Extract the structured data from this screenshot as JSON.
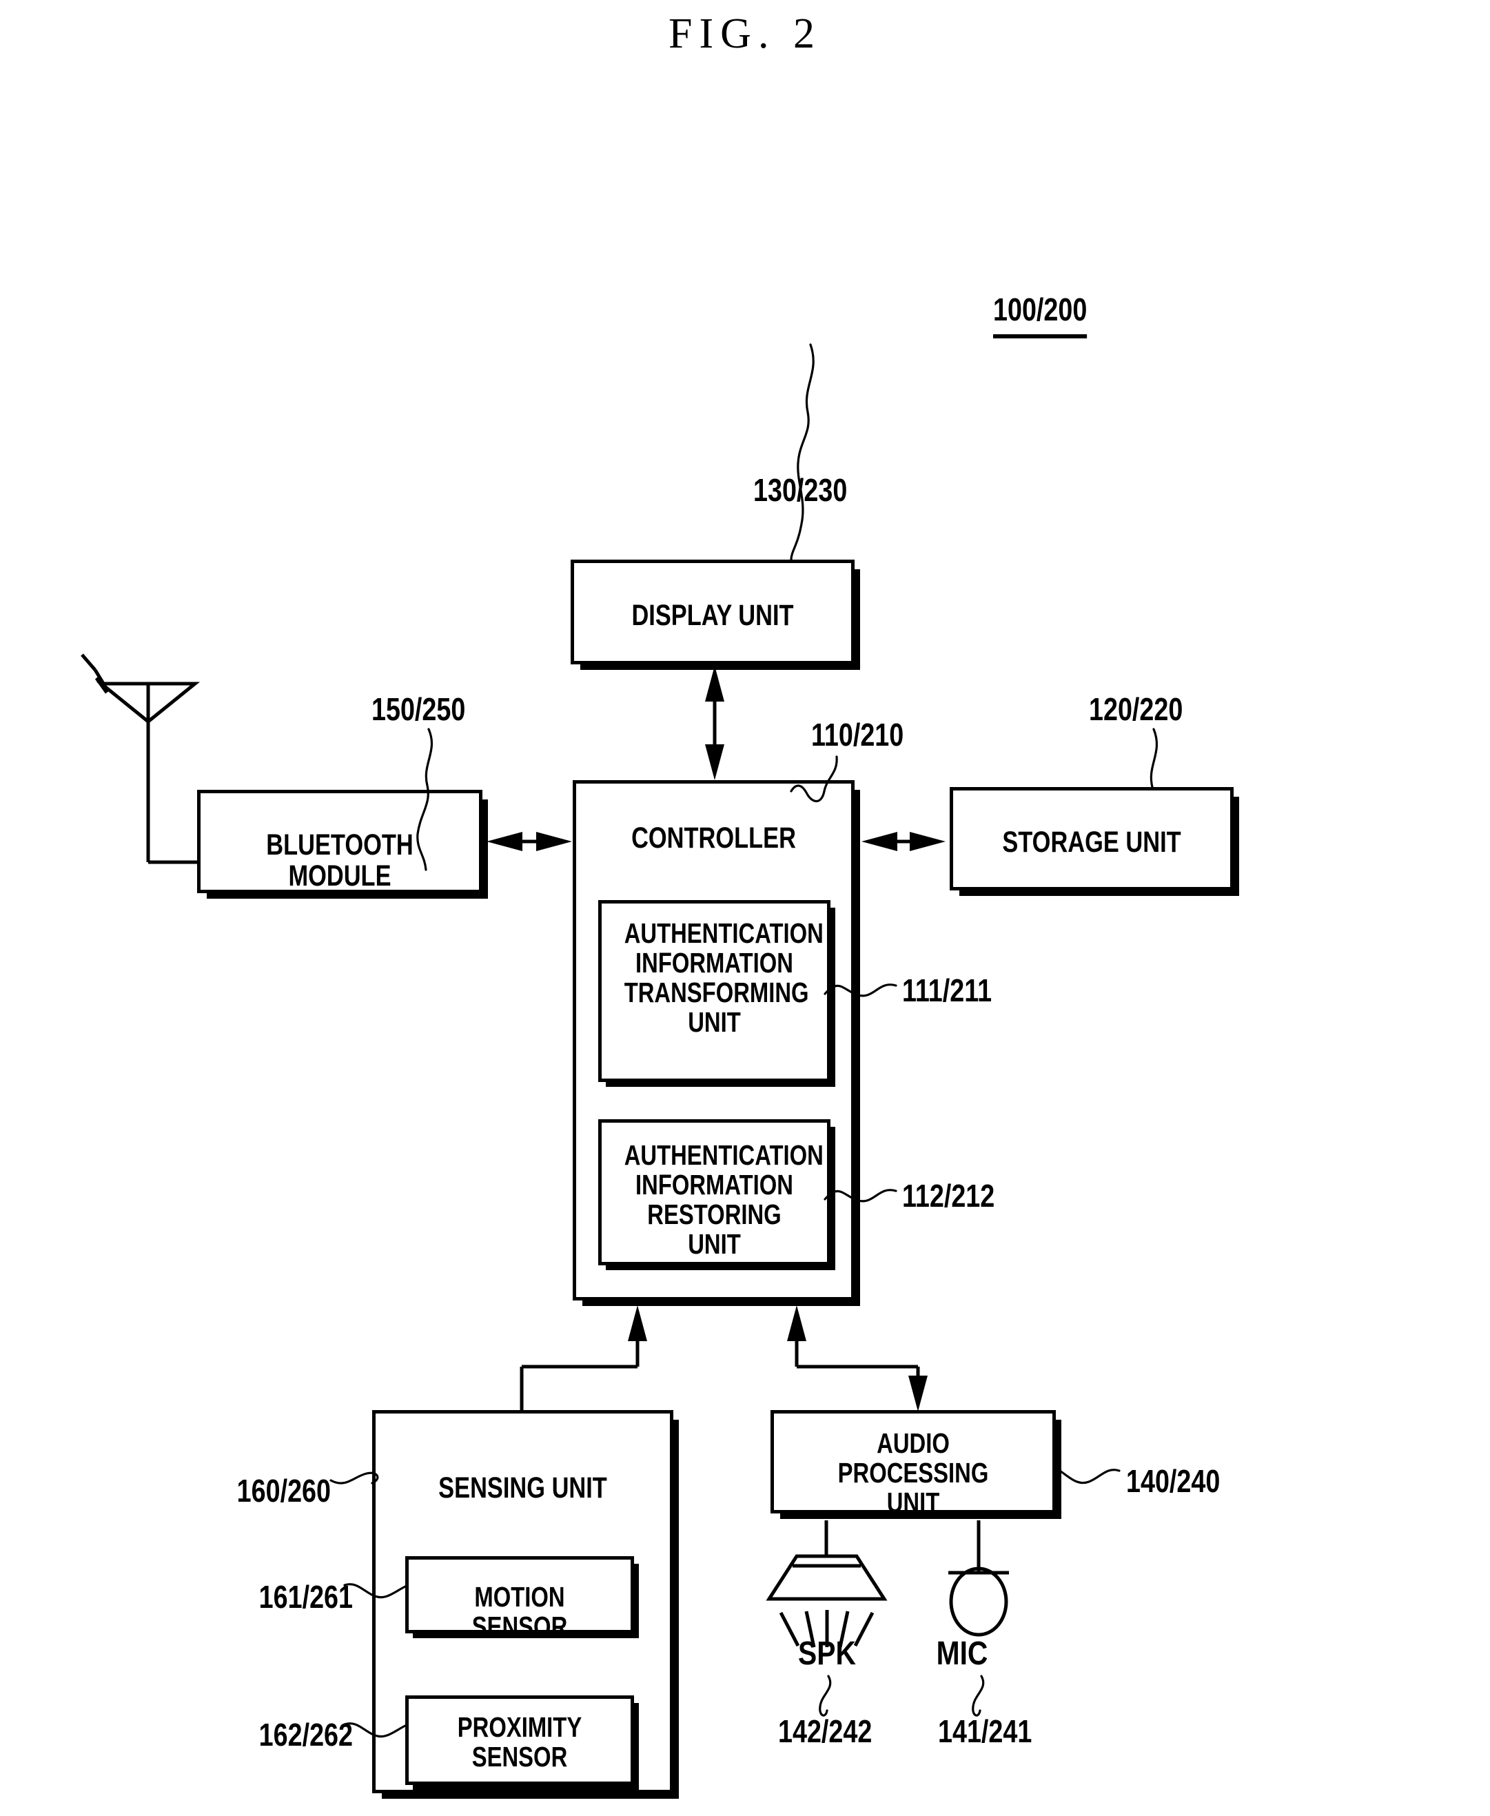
{
  "figure": {
    "title": "FIG. 2",
    "system_ref": "100/200"
  },
  "blocks": {
    "display_unit": {
      "label": "DISPLAY UNIT",
      "ref": "130/230"
    },
    "controller": {
      "label": "CONTROLLER",
      "ref": "110/210"
    },
    "bluetooth": {
      "label": "BLUETOOTH MODULE",
      "ref": "150/250"
    },
    "storage": {
      "label": "STORAGE UNIT",
      "ref": "120/220"
    },
    "auth_transform": {
      "label": "AUTHENTICATION\nINFORMATION\nTRANSFORMING\nUNIT",
      "ref": "111/211"
    },
    "auth_restore": {
      "label": "AUTHENTICATION\nINFORMATION\nRESTORING UNIT",
      "ref": "112/212"
    },
    "sensing": {
      "label": "SENSING UNIT",
      "ref": "160/260"
    },
    "motion_sensor": {
      "label": "MOTION SENSOR",
      "ref": "161/261"
    },
    "proximity_sensor": {
      "label": "PROXIMITY\nSENSOR",
      "ref": "162/262"
    },
    "audio": {
      "label": "AUDIO PROCESSING\nUNIT",
      "ref": "140/240"
    }
  },
  "peripherals": {
    "speaker": {
      "label": "SPK",
      "ref": "142/242",
      "icon": "speaker-icon"
    },
    "mic": {
      "label": "MIC",
      "ref": "141/241",
      "icon": "microphone-icon"
    },
    "antenna": {
      "icon": "antenna-icon"
    }
  },
  "colors": {
    "ink": "#000000",
    "paper": "#ffffff"
  }
}
